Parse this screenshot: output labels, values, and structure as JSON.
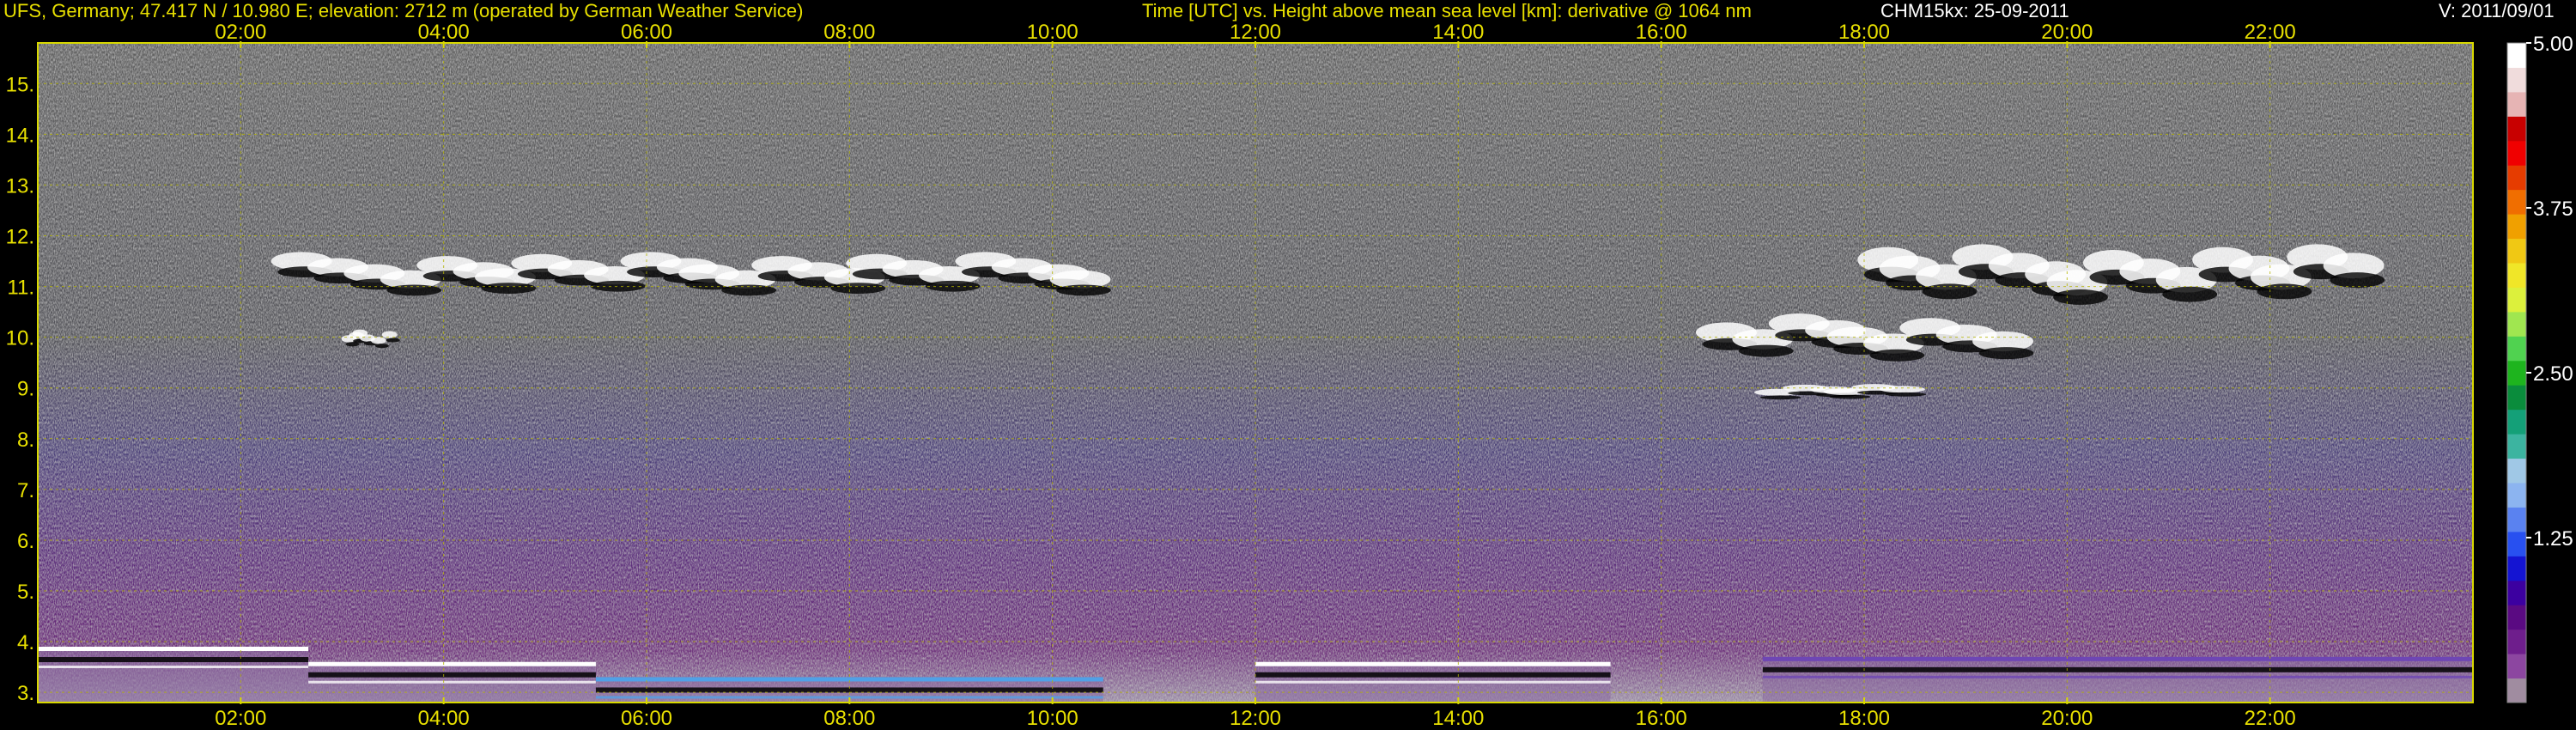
{
  "header": {
    "station": "UFS, Germany; 47.417 N / 10.980 E; elevation: 2712 m  (operated by German Weather Service)",
    "axes": "Time [UTC] vs. Height above mean sea level [km]: derivative @ 1064 nm",
    "instrument_date": "CHM15kx: 25-09-2011",
    "version": "V: 2011/09/01"
  },
  "chart_data": {
    "type": "heatmap",
    "title": "Time [UTC] vs. Height above mean sea level [km]: derivative @ 1064 nm",
    "x_ticks": [
      "02:00",
      "04:00",
      "06:00",
      "08:00",
      "10:00",
      "12:00",
      "14:00",
      "16:00",
      "18:00",
      "20:00",
      "22:00"
    ],
    "x_range": [
      "00:00",
      "24:00"
    ],
    "y_ticks": [
      "3.",
      "4.",
      "5.",
      "6.",
      "7.",
      "8.",
      "9.",
      "10.",
      "11.",
      "12.",
      "13.",
      "14.",
      "15."
    ],
    "y_range": [
      2.8,
      15.8
    ],
    "colorbar": {
      "ticks": [
        "1.25",
        "2.50",
        "3.75",
        "5.00"
      ],
      "range": [
        0,
        5
      ],
      "colors": [
        "#a08ca0",
        "#8c46a0",
        "#6e1e8c",
        "#5a0a82",
        "#3c00a0",
        "#1414d2",
        "#2850f0",
        "#5a82f0",
        "#8cb4f0",
        "#a0c8e6",
        "#3cb4a0",
        "#14a078",
        "#0a8c3c",
        "#1eb41e",
        "#50d250",
        "#a0e650",
        "#dcf03c",
        "#f0e628",
        "#f0c814",
        "#f0a000",
        "#f06e00",
        "#e63c00",
        "#f00000",
        "#c80000",
        "#e6b4b4",
        "#f0dcdc",
        "#ffffff"
      ]
    },
    "cloud_layers": [
      {
        "start": "02:30",
        "end": "10:30",
        "base_km": 10.8,
        "top_km": 11.8
      },
      {
        "start": "03:00",
        "end": "03:30",
        "base_km": 9.8,
        "top_km": 10.2
      },
      {
        "start": "16:30",
        "end": "19:30",
        "base_km": 9.5,
        "top_km": 10.6
      },
      {
        "start": "18:00",
        "end": "23:00",
        "base_km": 10.6,
        "top_km": 12.0
      },
      {
        "start": "17:00",
        "end": "18:30",
        "base_km": 8.8,
        "top_km": 9.1
      }
    ],
    "boundary_layer": [
      {
        "start": "00:00",
        "end": "02:40",
        "top_km": 3.9,
        "color": "#ffffff"
      },
      {
        "start": "02:40",
        "end": "05:30",
        "top_km": 3.6,
        "color": "#ffffff"
      },
      {
        "start": "05:30",
        "end": "10:30",
        "top_km": 3.3,
        "color": "#50a0e6"
      },
      {
        "start": "12:00",
        "end": "15:30",
        "top_km": 3.6,
        "color": "#ffffff"
      },
      {
        "start": "17:00",
        "end": "24:00",
        "top_km": 3.7,
        "color": "#6e46b4"
      }
    ]
  }
}
